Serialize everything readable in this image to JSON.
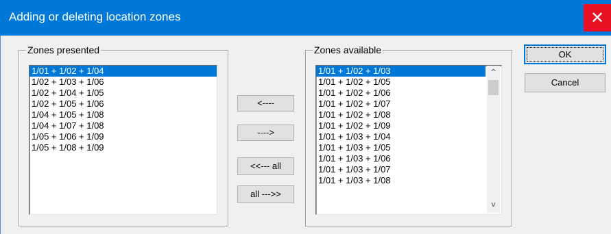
{
  "window": {
    "title": "Adding or deleting location zones",
    "close_glyph": "✕"
  },
  "zones_presented": {
    "label": "Zones presented",
    "items": [
      "1/01 + 1/02 + 1/04",
      "1/02 + 1/03 + 1/06",
      "1/02 + 1/04 + 1/05",
      "1/02 + 1/05 + 1/06",
      "1/04 + 1/05 + 1/08",
      "1/04 + 1/07 + 1/08",
      "1/05 + 1/06 + 1/09",
      "1/05 + 1/08 + 1/09"
    ],
    "selected_index": 0
  },
  "zones_available": {
    "label": "Zones available",
    "items": [
      "1/01 + 1/02 + 1/03",
      "1/01 + 1/02 + 1/05",
      "1/01 + 1/02 + 1/06",
      "1/01 + 1/02 + 1/07",
      "1/01 + 1/02 + 1/08",
      "1/01 + 1/02 + 1/09",
      "1/01 + 1/03 + 1/04",
      "1/01 + 1/03 + 1/05",
      "1/01 + 1/03 + 1/06",
      "1/01 + 1/03 + 1/07",
      "1/01 + 1/03 + 1/08"
    ],
    "selected_index": 0,
    "scroll_up_icon": "^",
    "scroll_down_icon": "v"
  },
  "buttons": {
    "move_left": "<----",
    "move_right": "---->",
    "move_all_left": "<<--- all",
    "move_all_right": "all --->>",
    "ok": "OK",
    "cancel": "Cancel"
  },
  "colors": {
    "title_bar": "#0078d7",
    "close_button": "#e81123",
    "selection": "#0078d7"
  }
}
